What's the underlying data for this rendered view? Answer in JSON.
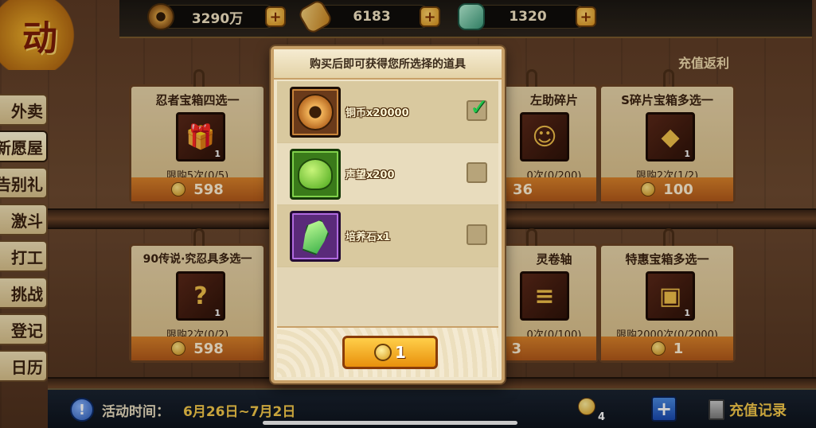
{
  "currency": [
    {
      "value": "3290万",
      "icon": "copper-coin-icon"
    },
    {
      "value": "6183",
      "icon": "scroll-icon"
    },
    {
      "value": "1320",
      "icon": "jade-icon"
    }
  ],
  "logo_text": "动",
  "sidebar": {
    "items": [
      {
        "label": "外卖"
      },
      {
        "label": "新愿屋"
      },
      {
        "label": "告别礼"
      },
      {
        "label": "激斗"
      },
      {
        "label": "打工"
      },
      {
        "label": "挑战"
      },
      {
        "label": "登记"
      },
      {
        "label": "日历"
      }
    ]
  },
  "recharge_return": "充值返利",
  "cards": [
    {
      "title": "忍者宝箱四选一",
      "item": "gift-box-icon",
      "count": "1",
      "limit": "限购5次(0/5)",
      "price": "598"
    },
    {
      "title": "左助碎片",
      "item": "ninja-portrait-icon",
      "count": "",
      "limit": "0次(0/200)",
      "price": "36"
    },
    {
      "title": "S碎片宝箱多选一",
      "item": "red-chest-icon",
      "count": "1",
      "limit": "限购2次(1/2)",
      "price": "100"
    },
    {
      "title": "90传说·究忍具多选一",
      "item": "mystery-chest-icon",
      "count": "1",
      "limit": "限购2次(0/2)",
      "price": "598"
    },
    {
      "title": "灵卷轴",
      "item": "scroll-item-icon",
      "count": "",
      "limit": "0次(0/100)",
      "price": "3"
    },
    {
      "title": "特惠宝箱多选一",
      "item": "gold-chest-icon",
      "count": "1",
      "limit": "限购2000次(0/2000)",
      "price": "1"
    }
  ],
  "modal": {
    "title": "购买后即可获得您所选择的道具",
    "options": [
      {
        "label": "铜币x20000",
        "icon": "copper-coin-icon",
        "checked": true
      },
      {
        "label": "声望x200",
        "icon": "frog-icon",
        "checked": false
      },
      {
        "label": "培养石x1",
        "icon": "green-gem-icon",
        "checked": false
      }
    ],
    "buy_price": "1",
    "check_mark": "✓"
  },
  "bottombar": {
    "info_icon": "!",
    "time_label": "活动时间：",
    "time_value": "6月26日~7月2日",
    "bell_count": "4",
    "add_symbol": "+",
    "record_label": "充值记录"
  },
  "colors": {
    "accent": "#e8900c",
    "check": "#1fc84a",
    "highlight": "#f4c84a"
  }
}
